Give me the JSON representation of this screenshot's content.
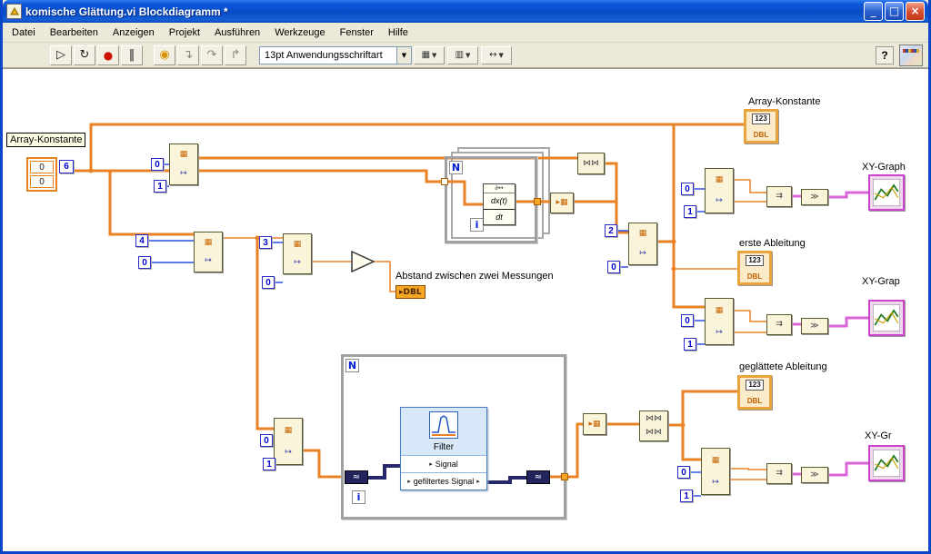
{
  "window": {
    "title": "komische Glättung.vi Blockdiagramm *",
    "controls": {
      "minimize": "_",
      "maximize": "□",
      "close": "×"
    }
  },
  "menu": {
    "items": [
      {
        "label": "Datei"
      },
      {
        "label": "Bearbeiten"
      },
      {
        "label": "Anzeigen"
      },
      {
        "label": "Projekt"
      },
      {
        "label": "Ausführen"
      },
      {
        "label": "Werkzeuge"
      },
      {
        "label": "Fenster"
      },
      {
        "label": "Hilfe"
      }
    ]
  },
  "toolbar": {
    "font_selector": "13pt Anwendungsschriftart",
    "icons": {
      "run": "▷",
      "run_continuous": "↻",
      "abort": "●",
      "pause": "‖",
      "highlight": "◉",
      "step_into": "↴",
      "step_over": "↷",
      "step_out": "↱",
      "dropdown": "▼",
      "align": "▦",
      "distribute": "▥",
      "resize": "↔",
      "help": "?"
    }
  },
  "diagram": {
    "labels": {
      "array_const_left": "Array-Konstante",
      "array_const_right": "Array-Konstante",
      "abstand": "Abstand zwischen zwei Messungen",
      "xy_graph_top": "XY-Graph",
      "erste_ableitung": "erste Ableitung",
      "xy_graph_mid": "XY-Grap",
      "geglaettete_ableitung": "geglättete Ableitung",
      "xy_graph_bottom": "XY-Gr"
    },
    "constants": {
      "array_el1": "0",
      "array_el2": "0",
      "size": "6",
      "c1": "0",
      "c2": "1",
      "c3": "4",
      "c4": "0",
      "c5": "3",
      "c6": "0",
      "c7": "2",
      "c8": "0",
      "c9": "0",
      "c10": "1",
      "c11": "0",
      "c12": "1",
      "c13": "0",
      "c14": "1",
      "c15": "0",
      "c16": "1"
    },
    "loop": {
      "count": "N",
      "iteration": "i"
    },
    "formula": {
      "header": "∂↔",
      "numerator": "dx(t)",
      "denominator": "dt"
    },
    "dbl_block": {
      "icon": "123",
      "type": "DBL"
    },
    "local_variable": {
      "text": "▸DBL"
    },
    "express_vi": {
      "title": "Filter",
      "input_row": "Signal",
      "output_row": "gefiltertes Signal"
    },
    "node_glyphs": {
      "array": "▦",
      "index": "↦",
      "bundle": "⇉",
      "convert": "≫",
      "interleave": "⋈⋈",
      "build": "▸▦",
      "dynamic": "≈",
      "pin": "▸"
    }
  }
}
